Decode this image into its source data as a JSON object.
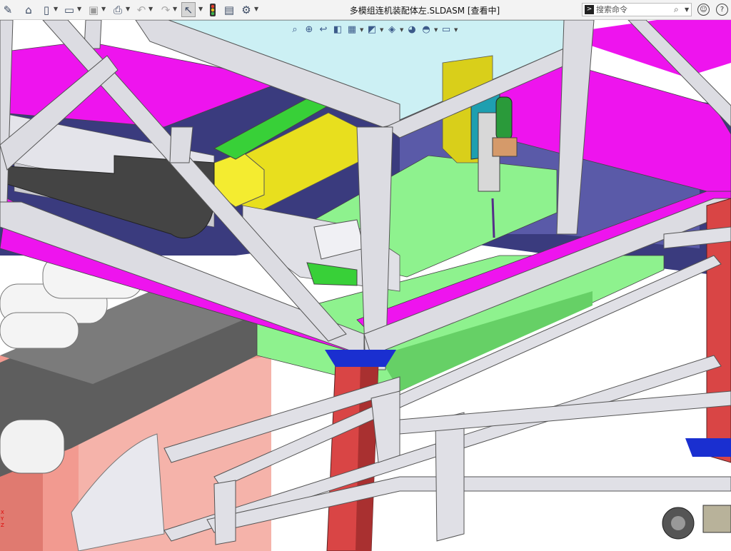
{
  "window": {
    "title": "多模组连机装配体左.SLDASM [查看中]"
  },
  "toolbar": {
    "icons": [
      "pin-icon",
      "home-icon",
      "new-icon",
      "open-icon",
      "save-icon",
      "print-icon",
      "undo-icon",
      "redo-icon",
      "select-icon",
      "traffic-light-icon",
      "file-properties-icon",
      "options-gear-icon"
    ]
  },
  "search": {
    "placeholder": "搜索命令"
  },
  "heads_up_toolbar": {
    "icons": [
      "zoom-to-fit-icon",
      "zoom-area-icon",
      "previous-view-icon",
      "section-view-icon",
      "dynamic-annotation-icon",
      "view-orientation-icon",
      "display-style-icon",
      "hide-show-icon",
      "edit-appearance-icon",
      "apply-scene-icon",
      "view-settings-icon"
    ]
  },
  "triad": {
    "labels": [
      "X",
      "Y",
      "Z"
    ]
  },
  "colors": {
    "magenta": "#ee14ee",
    "green": "#8ef28e",
    "yellow": "#e8df1e",
    "red_column": "#d94545",
    "frame_gray": "#dcdce2",
    "glass_top": "#ccf0f4",
    "floor_pink": "#f29a90",
    "navy_bg": "#3a3b7e"
  }
}
